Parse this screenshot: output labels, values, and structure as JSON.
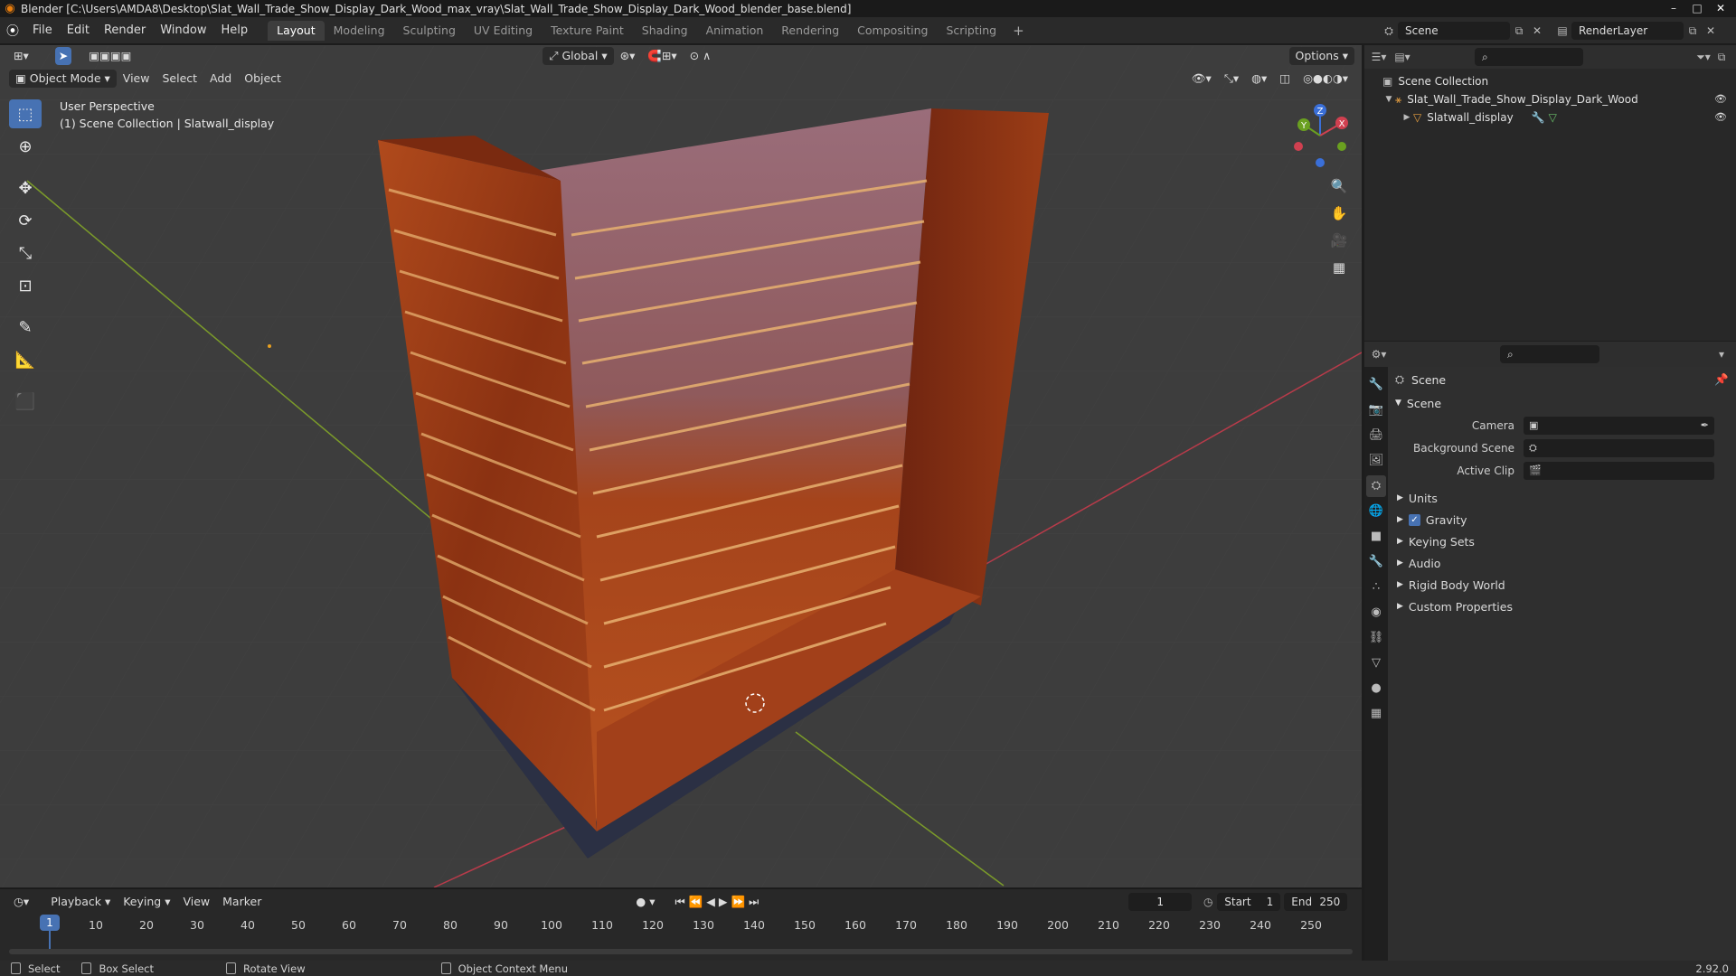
{
  "titlebar": {
    "title": "Blender [C:\\Users\\AMDA8\\Desktop\\Slat_Wall_Trade_Show_Display_Dark_Wood_max_vray\\Slat_Wall_Trade_Show_Display_Dark_Wood_blender_base.blend]",
    "minimize": "–",
    "maximize": "□",
    "close": "✕"
  },
  "menu": [
    "File",
    "Edit",
    "Render",
    "Window",
    "Help"
  ],
  "workspaces": [
    "Layout",
    "Modeling",
    "Sculpting",
    "UV Editing",
    "Texture Paint",
    "Shading",
    "Animation",
    "Rendering",
    "Compositing",
    "Scripting"
  ],
  "workspace_add": "+",
  "scene": {
    "name": "Scene",
    "render_layer": "RenderLayer"
  },
  "viewport": {
    "mode": "Object Mode",
    "menus": [
      "View",
      "Select",
      "Add",
      "Object"
    ],
    "transform_orientation": "Global",
    "options": "Options",
    "perspective_label": "User Perspective",
    "collection_label": "(1) Scene Collection | Slatwall_display",
    "gizmo_x": "X",
    "gizmo_y": "Y",
    "gizmo_z": "Z"
  },
  "timeline": {
    "menus": [
      "Playback",
      "Keying",
      "View",
      "Marker"
    ],
    "current_frame": "1",
    "start_label": "Start",
    "start": "1",
    "end_label": "End",
    "end": "250",
    "ruler": [
      "10",
      "20",
      "30",
      "40",
      "50",
      "60",
      "70",
      "80",
      "90",
      "100",
      "110",
      "120",
      "130",
      "140",
      "150",
      "160",
      "170",
      "180",
      "190",
      "200",
      "210",
      "220",
      "230",
      "240",
      "250"
    ],
    "cursor_frame": "1"
  },
  "statusbar": {
    "select": "Select",
    "box_select": "Box Select",
    "rotate_view": "Rotate View",
    "context_menu": "Object Context Menu",
    "version": "2.92.0"
  },
  "outliner": {
    "root": "Scene Collection",
    "collection": "Slat_Wall_Trade_Show_Display_Dark_Wood",
    "object": "Slatwall_display"
  },
  "properties": {
    "context": "Scene",
    "panel": "Scene",
    "camera_label": "Camera",
    "background_scene_label": "Background Scene",
    "active_clip_label": "Active Clip",
    "subpanels": [
      "Units",
      "Gravity",
      "Keying Sets",
      "Audio",
      "Rigid Body World",
      "Custom Properties"
    ],
    "gravity_checked": true
  },
  "colors": {
    "accent": "#4772b3",
    "viewport_bg": "#3d3d3d",
    "wood_light": "#a8431a",
    "wood_dark": "#6e2410"
  }
}
